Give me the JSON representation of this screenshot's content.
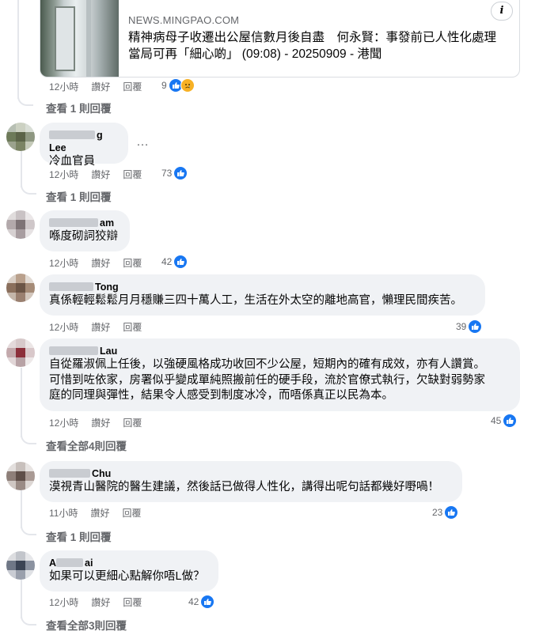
{
  "link_preview": {
    "domain": "NEWS.MINGPAO.COM",
    "title": "精神病母子收遷出公屋信數月後自盡　何永賢：事發前已人性化處理　當局可再「細心啲」 (09:08) - 20250909 - 港聞",
    "info_label": "i"
  },
  "post": {
    "time": "12小時",
    "like_label": "讚好",
    "reply_label": "回覆",
    "reaction_count": "9",
    "view_replies": "查看 1 則回覆"
  },
  "comments": [
    {
      "author_suffix": "g Lee",
      "text": "冷血官員",
      "time": "12小時",
      "like_label": "讚好",
      "reply_label": "回覆",
      "reaction_count": "73",
      "view_replies": "查看 1 則回覆"
    },
    {
      "author_suffix": "am",
      "text": "喺度砌詞狡辯",
      "time": "12小時",
      "like_label": "讚好",
      "reply_label": "回覆",
      "reaction_count": "42",
      "view_replies": ""
    },
    {
      "author_suffix": "Tong",
      "text": "真係輕輕鬆鬆月月穩賺三四十萬人工，生活在外太空的離地高官，懶理民間疾苦。",
      "time": "12小時",
      "like_label": "讚好",
      "reply_label": "回覆",
      "reaction_count": "39",
      "view_replies": ""
    },
    {
      "author_suffix": "Lau",
      "text_lines": [
        "自從羅淑佩上任後，以強硬風格成功收回不少公屋，短期內的確有成效，亦有人讚賞。",
        "可惜到咗依家，房署似乎變成單純照搬前任的硬手段，流於官僚式執行，欠缺對弱勢家",
        "庭的同理與彈性，結果令人感受到制度冰冷，而唔係真正以民為本。"
      ],
      "time": "12小時",
      "like_label": "讚好",
      "reply_label": "回覆",
      "reaction_count": "45",
      "view_replies": "查看全部4則回覆"
    },
    {
      "author_suffix": "Chu",
      "text": "漠視青山醫院的醫生建議，然後話已做得人性化，講得出呢句話都幾好嘢喎！",
      "time": "11小時",
      "like_label": "讚好",
      "reply_label": "回覆",
      "reaction_count": "23",
      "view_replies": "查看 1 則回覆"
    },
    {
      "author_prefix": "A",
      "author_suffix": "ai",
      "text": "如果可以更細心點解你唔L做？",
      "time": "12小時",
      "like_label": "讚好",
      "reply_label": "回覆",
      "reaction_count": "42",
      "view_replies": "查看全部3則回覆"
    }
  ],
  "more_menu": "…",
  "colors": {
    "like_blue": "#1877f2",
    "bubble_bg": "#f0f2f5",
    "meta_gray": "#65676b"
  }
}
